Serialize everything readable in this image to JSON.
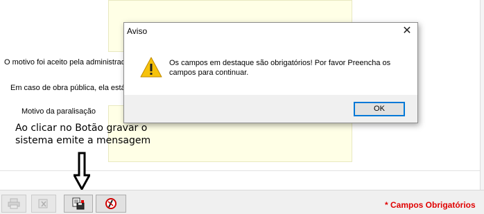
{
  "form": {
    "label_motivo_aceito": "O motivo foi aceito pela administrad",
    "label_obra_publica": "Em caso de obra pública, ela está",
    "label_motivo_paralisacao": "Motivo da paralisação"
  },
  "annotation": {
    "line1": "Ao clicar no Botão gravar o",
    "line2": "sistema emite a mensagem"
  },
  "toolbar": {
    "buttons": [
      "print-icon",
      "clear-icon",
      "save-icon",
      "cancel-icon"
    ],
    "required_note": "* Campos Obrigatórios"
  },
  "dialog": {
    "title": "Aviso",
    "close_glyph": "✕",
    "message": "Os campos em destaque são obrigatórios! Por favor Preencha os campos para continuar.",
    "ok_label": "OK",
    "icon": "warning-icon"
  },
  "colors": {
    "field_background": "#ffffe6",
    "required_text": "#e00000",
    "focus_border": "#0078d7"
  }
}
